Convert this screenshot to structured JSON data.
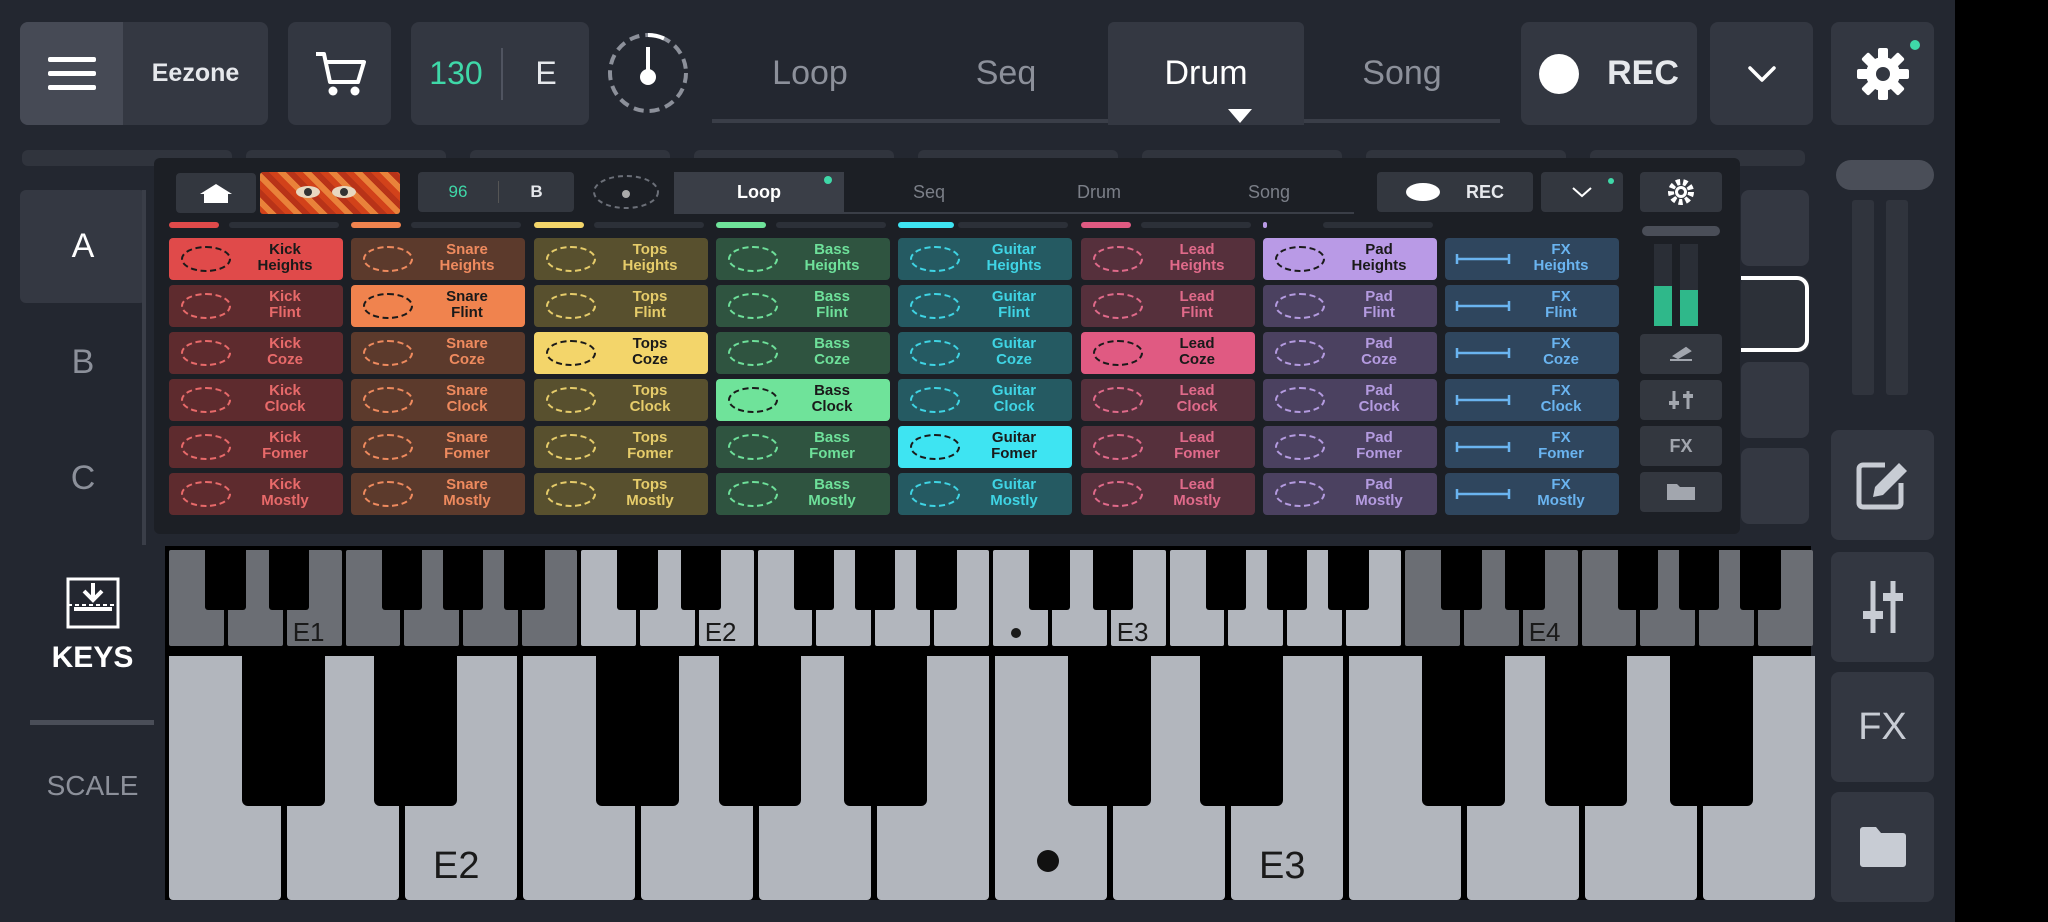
{
  "topbar": {
    "project_name": "Eezone",
    "tempo": "130",
    "key": "E",
    "tabs": [
      "Loop",
      "Seq",
      "Drum",
      "Song"
    ],
    "active_tab": "Drum",
    "rec_label": "REC"
  },
  "sections": [
    "A",
    "B",
    "C"
  ],
  "inner": {
    "tempo": "96",
    "key": "B",
    "tabs": [
      "Loop",
      "Seq",
      "Drum",
      "Song"
    ],
    "active_tab": "Loop",
    "rec_label": "REC",
    "fx_label": "FX",
    "pad_columns": [
      {
        "instrument": "Kick",
        "color": "#e04a4a",
        "dim": "#5e2b2e",
        "text": "#e86a6a"
      },
      {
        "instrument": "Snare",
        "color": "#f0834e",
        "dim": "#5c3a2c",
        "text": "#ee8a5e"
      },
      {
        "instrument": "Tops",
        "color": "#f3d56a",
        "dim": "#58502e",
        "text": "#e6cc6a"
      },
      {
        "instrument": "Bass",
        "color": "#6fe39a",
        "dim": "#2f5440",
        "text": "#6ee09a"
      },
      {
        "instrument": "Guitar",
        "color": "#3ee4f2",
        "dim": "#255a62",
        "text": "#3fd4e4"
      },
      {
        "instrument": "Lead",
        "color": "#e05a82",
        "dim": "#56303c",
        "text": "#e06a8a"
      },
      {
        "instrument": "Pad",
        "color": "#b99ae6",
        "dim": "#4b4160",
        "text": "#b49be0"
      },
      {
        "instrument": "FX",
        "color": "#5fb0f0",
        "dim": "#2f465e",
        "text": "#6ab4f0"
      }
    ],
    "pad_rows": [
      "Heights",
      "Flint",
      "Coze",
      "Clock",
      "Fomer",
      "Mostly"
    ],
    "active_pads": [
      0,
      1,
      2,
      3,
      4,
      2,
      0,
      0
    ]
  },
  "keyboard": {
    "keys_label": "KEYS",
    "scale_label": "SCALE",
    "mini_labels": [
      "E1",
      "E2",
      "E3",
      "E4"
    ],
    "big_labels": [
      "E2",
      "E3"
    ]
  },
  "sidebar": {
    "fx_label": "FX"
  },
  "icons": [
    "menu-icon",
    "cart-icon",
    "metronome-icon",
    "chevron-down-icon",
    "gear-icon",
    "edit-icon",
    "mixer-icon",
    "folder-icon",
    "keys-icon",
    "home-icon"
  ]
}
